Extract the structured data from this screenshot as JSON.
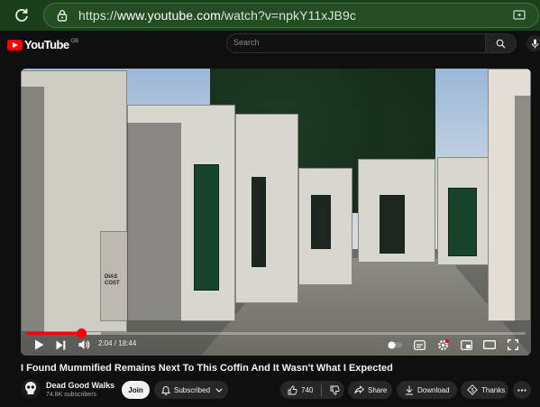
{
  "browser": {
    "url_prefix": "https://",
    "url_domain": "www.youtube.com",
    "url_path": "/watch?v=npkY11xJB9c"
  },
  "header": {
    "logo_text": "YouTube",
    "region": "GB",
    "search_placeholder": "Search"
  },
  "player": {
    "current_time": "2:04",
    "separator": " / ",
    "duration": "18:44",
    "progress_fraction": 0.11,
    "buffered_fraction": 0.15,
    "graffiti": "DIAS\nCOST"
  },
  "video": {
    "title": "I Found Mummified Remains Next To This Coffin And It Wasn't What I Expected"
  },
  "channel": {
    "name": "Dead Good Walks",
    "subscribers": "74.8K subscribers"
  },
  "actions": {
    "join": "Join",
    "subscribed": "Subscribed",
    "likes": "740",
    "share": "Share",
    "download": "Download",
    "thanks": "Thanks"
  },
  "colors": {
    "brand_red": "#ff0000",
    "browser_bar": "#1b3f1b",
    "page_bg": "#0f0f0f"
  }
}
